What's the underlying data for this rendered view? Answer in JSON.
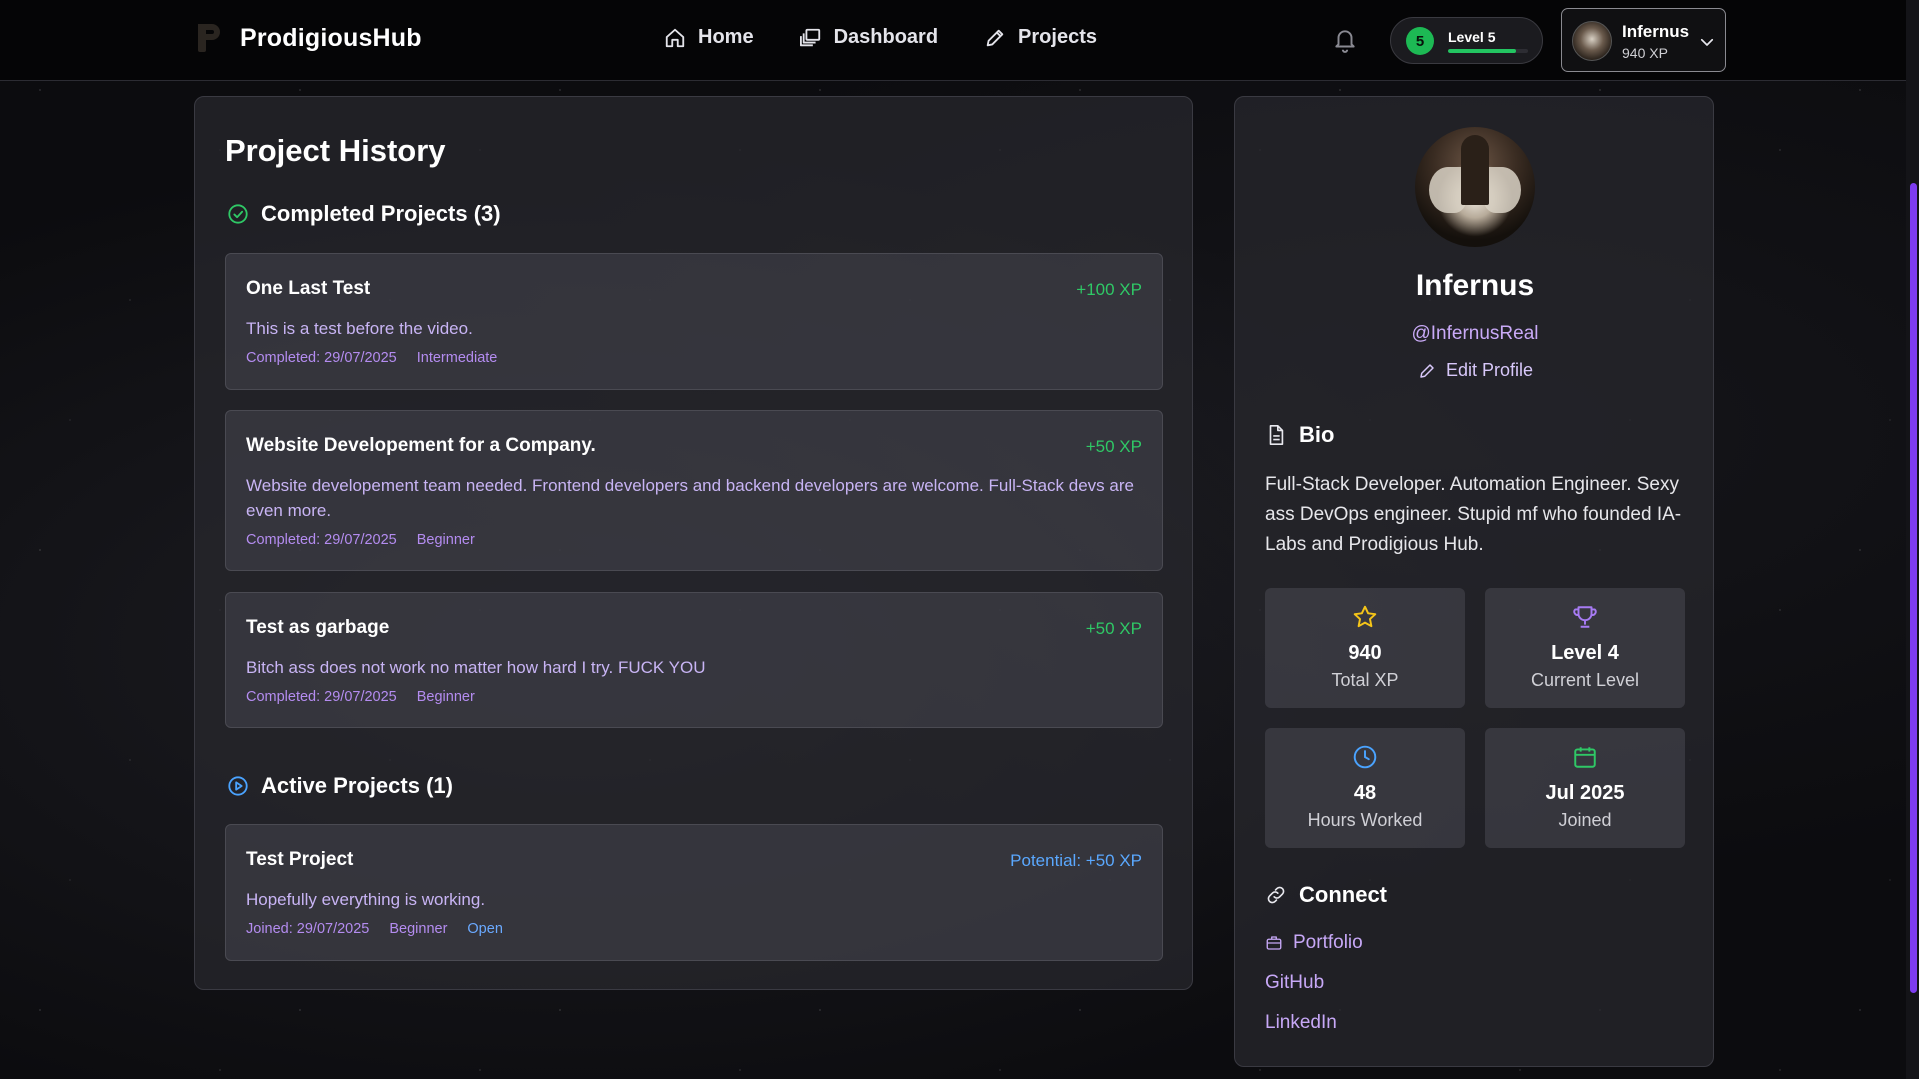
{
  "app": {
    "brand": "ProdigiousHub"
  },
  "nav": {
    "links": [
      {
        "label": "Home",
        "icon": "home-icon"
      },
      {
        "label": "Dashboard",
        "icon": "dashboard-icon"
      },
      {
        "label": "Projects",
        "icon": "pencil-icon"
      }
    ]
  },
  "header": {
    "level_number": "5",
    "level_label": "Level 5",
    "level_progress_percent": 85,
    "user_name": "Infernus",
    "user_xp": "940 XP"
  },
  "history": {
    "title": "Project History",
    "completed_heading": "Completed Projects (3)",
    "completed": [
      {
        "title": "One Last Test",
        "xp": "+100 XP",
        "description": "This is a test before the video.",
        "completed": "Completed: 29/07/2025",
        "level": "Intermediate"
      },
      {
        "title": "Website Developement for a Company.",
        "xp": "+50 XP",
        "description": "Website developement team needed. Frontend developers and backend developers are welcome. Full-Stack devs are even more.",
        "completed": "Completed: 29/07/2025",
        "level": "Beginner"
      },
      {
        "title": "Test as garbage",
        "xp": "+50 XP",
        "description": "Bitch ass does not work no matter how hard I try. FUCK YOU",
        "completed": "Completed: 29/07/2025",
        "level": "Beginner"
      }
    ],
    "active_heading": "Active Projects (1)",
    "active": [
      {
        "title": "Test Project",
        "xp": "Potential: +50 XP",
        "description": "Hopefully everything is working.",
        "joined": "Joined: 29/07/2025",
        "level": "Beginner",
        "status": "Open"
      }
    ]
  },
  "profile": {
    "name": "Infernus",
    "handle": "@InfernusReal",
    "edit_label": "Edit Profile",
    "bio_heading": "Bio",
    "bio": "Full-Stack Developer. Automation Engineer. Sexy ass DevOps engineer. Stupid mf who founded IA-Labs and Prodigious Hub.",
    "stats": [
      {
        "value": "940",
        "label": "Total XP",
        "icon": "star-icon",
        "color": "#f5c518"
      },
      {
        "value": "Level 4",
        "label": "Current Level",
        "icon": "trophy-icon",
        "color": "#a77bf3"
      },
      {
        "value": "48",
        "label": "Hours Worked",
        "icon": "clock-icon",
        "color": "#4aa3ff"
      },
      {
        "value": "Jul 2025",
        "label": "Joined",
        "icon": "calendar-icon",
        "color": "#2fc866"
      }
    ],
    "connect_heading": "Connect",
    "links": [
      {
        "label": "Portfolio",
        "icon": "briefcase-icon"
      },
      {
        "label": "GitHub"
      },
      {
        "label": "LinkedIn"
      }
    ]
  },
  "colors": {
    "accent": "#7d3cf0",
    "success": "#2fc866",
    "link_purple": "#c7a8f7"
  }
}
